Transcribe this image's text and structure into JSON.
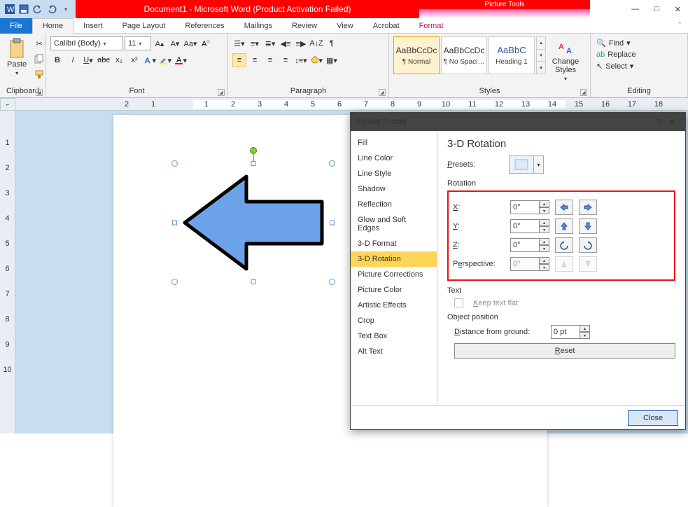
{
  "title": "Document1 - Microsoft Word (Product Activation Failed)",
  "tools_label": "Picture Tools",
  "window_controls": {
    "min": "—",
    "max": "□",
    "close": "✕"
  },
  "tabs": {
    "file": "File",
    "items": [
      "Home",
      "Insert",
      "Page Layout",
      "References",
      "Mailings",
      "Review",
      "View",
      "Acrobat",
      "Format"
    ],
    "active": "Home"
  },
  "ribbon": {
    "clipboard": {
      "label": "Clipboard",
      "paste": "Paste"
    },
    "font": {
      "label": "Font",
      "family": "Calibri (Body)",
      "size": "11"
    },
    "paragraph": {
      "label": "Paragraph"
    },
    "styles": {
      "label": "Styles",
      "sample": "AaBbCcDc",
      "sample_h": "AaBbC",
      "items": [
        "¶ Normal",
        "¶ No Spaci…",
        "Heading 1"
      ],
      "change": "Change Styles"
    },
    "editing": {
      "label": "Editing",
      "find": "Find",
      "replace": "Replace",
      "select": "Select"
    }
  },
  "ruler_h": [
    "2",
    "1",
    "",
    "1",
    "2",
    "3",
    "4",
    "5",
    "6",
    "7",
    "8",
    "9",
    "10",
    "11",
    "12",
    "13",
    "14",
    "15",
    "16",
    "17",
    "18"
  ],
  "ruler_v": [
    "",
    "1",
    "2",
    "3",
    "4",
    "5",
    "6",
    "7",
    "8",
    "9",
    "10"
  ],
  "dialog": {
    "title": "Format Picture",
    "help": "?",
    "close_x": "✕",
    "categories": [
      "Fill",
      "Line Color",
      "Line Style",
      "Shadow",
      "Reflection",
      "Glow and Soft Edges",
      "3-D Format",
      "3-D Rotation",
      "Picture Corrections",
      "Picture Color",
      "Artistic Effects",
      "Crop",
      "Text Box",
      "Alt Text"
    ],
    "selected_category": "3-D Rotation",
    "pane_title": "3-D Rotation",
    "presets_label": "Presets:",
    "rotation_label": "Rotation",
    "rows": {
      "x": {
        "label": "X:",
        "val": "0°"
      },
      "y": {
        "label": "Y:",
        "val": "0°"
      },
      "z": {
        "label": "Z:",
        "val": "0°"
      },
      "perspective": {
        "label": "Perspective:",
        "val": "0°"
      }
    },
    "text_section": "Text",
    "keep_flat": "Keep text flat",
    "objpos_section": "Object position",
    "dist_label": "Distance from ground:",
    "dist_val": "0 pt",
    "reset": "Reset",
    "close": "Close"
  }
}
